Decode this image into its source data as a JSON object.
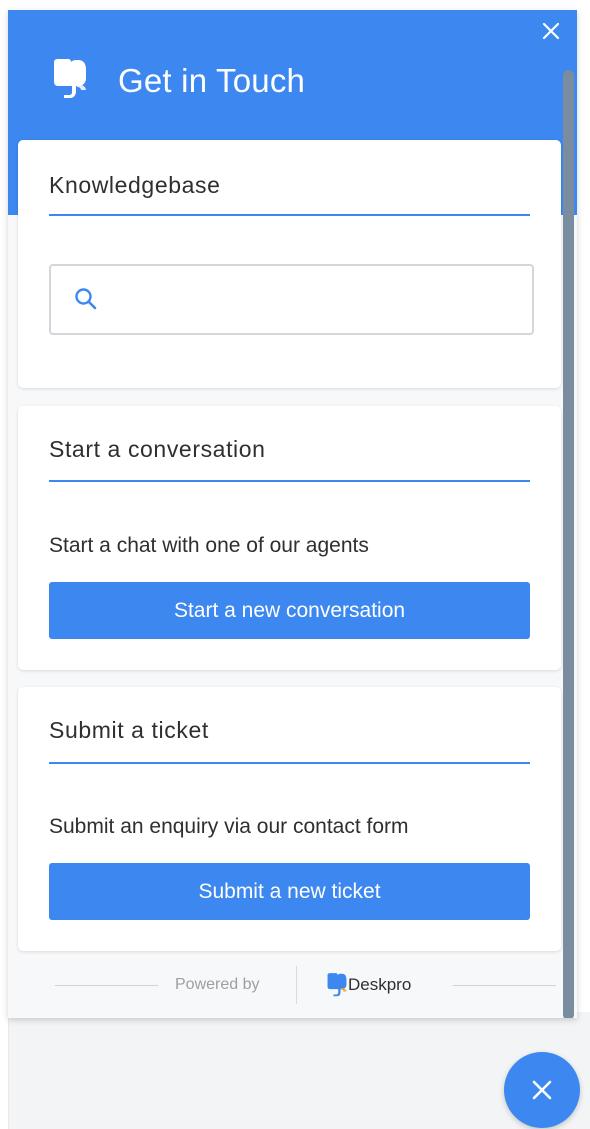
{
  "colors": {
    "accent": "#3c87f0",
    "scrollbar": "#7a8ca0",
    "text": "#2f2f2f",
    "muted": "#9aa0a6"
  },
  "header": {
    "title": "Get in Touch",
    "logo_icon": "deskpro-elephant-icon",
    "close_icon": "close-icon"
  },
  "knowledgebase": {
    "title": "Knowledgebase",
    "search": {
      "icon": "search-icon",
      "value": "",
      "placeholder": ""
    }
  },
  "conversation": {
    "title": "Start a conversation",
    "description": "Start a chat with one of our agents",
    "button_label": "Start a new conversation"
  },
  "ticket": {
    "title": "Submit a ticket",
    "description": "Submit an enquiry via our contact form",
    "button_label": "Submit a new ticket"
  },
  "footer": {
    "powered_by": "Powered by",
    "brand": "Deskpro",
    "brand_icon": "deskpro-elephant-icon"
  },
  "launcher": {
    "icon": "close-icon"
  }
}
